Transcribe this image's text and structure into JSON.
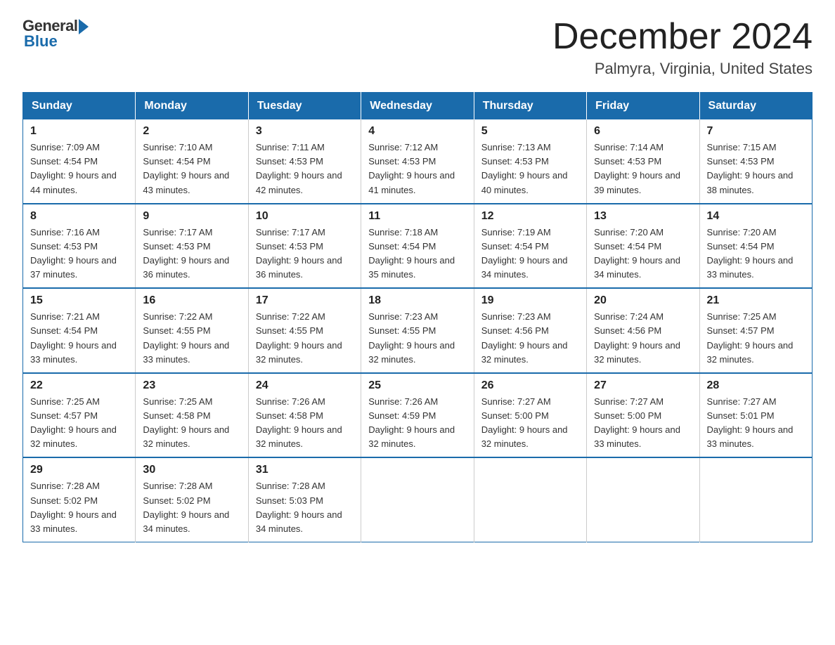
{
  "logo": {
    "general": "General",
    "blue": "Blue"
  },
  "title": "December 2024",
  "subtitle": "Palmyra, Virginia, United States",
  "days_of_week": [
    "Sunday",
    "Monday",
    "Tuesday",
    "Wednesday",
    "Thursday",
    "Friday",
    "Saturday"
  ],
  "weeks": [
    [
      {
        "day": "1",
        "sunrise": "7:09 AM",
        "sunset": "4:54 PM",
        "daylight": "9 hours and 44 minutes."
      },
      {
        "day": "2",
        "sunrise": "7:10 AM",
        "sunset": "4:54 PM",
        "daylight": "9 hours and 43 minutes."
      },
      {
        "day": "3",
        "sunrise": "7:11 AM",
        "sunset": "4:53 PM",
        "daylight": "9 hours and 42 minutes."
      },
      {
        "day": "4",
        "sunrise": "7:12 AM",
        "sunset": "4:53 PM",
        "daylight": "9 hours and 41 minutes."
      },
      {
        "day": "5",
        "sunrise": "7:13 AM",
        "sunset": "4:53 PM",
        "daylight": "9 hours and 40 minutes."
      },
      {
        "day": "6",
        "sunrise": "7:14 AM",
        "sunset": "4:53 PM",
        "daylight": "9 hours and 39 minutes."
      },
      {
        "day": "7",
        "sunrise": "7:15 AM",
        "sunset": "4:53 PM",
        "daylight": "9 hours and 38 minutes."
      }
    ],
    [
      {
        "day": "8",
        "sunrise": "7:16 AM",
        "sunset": "4:53 PM",
        "daylight": "9 hours and 37 minutes."
      },
      {
        "day": "9",
        "sunrise": "7:17 AM",
        "sunset": "4:53 PM",
        "daylight": "9 hours and 36 minutes."
      },
      {
        "day": "10",
        "sunrise": "7:17 AM",
        "sunset": "4:53 PM",
        "daylight": "9 hours and 36 minutes."
      },
      {
        "day": "11",
        "sunrise": "7:18 AM",
        "sunset": "4:54 PM",
        "daylight": "9 hours and 35 minutes."
      },
      {
        "day": "12",
        "sunrise": "7:19 AM",
        "sunset": "4:54 PM",
        "daylight": "9 hours and 34 minutes."
      },
      {
        "day": "13",
        "sunrise": "7:20 AM",
        "sunset": "4:54 PM",
        "daylight": "9 hours and 34 minutes."
      },
      {
        "day": "14",
        "sunrise": "7:20 AM",
        "sunset": "4:54 PM",
        "daylight": "9 hours and 33 minutes."
      }
    ],
    [
      {
        "day": "15",
        "sunrise": "7:21 AM",
        "sunset": "4:54 PM",
        "daylight": "9 hours and 33 minutes."
      },
      {
        "day": "16",
        "sunrise": "7:22 AM",
        "sunset": "4:55 PM",
        "daylight": "9 hours and 33 minutes."
      },
      {
        "day": "17",
        "sunrise": "7:22 AM",
        "sunset": "4:55 PM",
        "daylight": "9 hours and 32 minutes."
      },
      {
        "day": "18",
        "sunrise": "7:23 AM",
        "sunset": "4:55 PM",
        "daylight": "9 hours and 32 minutes."
      },
      {
        "day": "19",
        "sunrise": "7:23 AM",
        "sunset": "4:56 PM",
        "daylight": "9 hours and 32 minutes."
      },
      {
        "day": "20",
        "sunrise": "7:24 AM",
        "sunset": "4:56 PM",
        "daylight": "9 hours and 32 minutes."
      },
      {
        "day": "21",
        "sunrise": "7:25 AM",
        "sunset": "4:57 PM",
        "daylight": "9 hours and 32 minutes."
      }
    ],
    [
      {
        "day": "22",
        "sunrise": "7:25 AM",
        "sunset": "4:57 PM",
        "daylight": "9 hours and 32 minutes."
      },
      {
        "day": "23",
        "sunrise": "7:25 AM",
        "sunset": "4:58 PM",
        "daylight": "9 hours and 32 minutes."
      },
      {
        "day": "24",
        "sunrise": "7:26 AM",
        "sunset": "4:58 PM",
        "daylight": "9 hours and 32 minutes."
      },
      {
        "day": "25",
        "sunrise": "7:26 AM",
        "sunset": "4:59 PM",
        "daylight": "9 hours and 32 minutes."
      },
      {
        "day": "26",
        "sunrise": "7:27 AM",
        "sunset": "5:00 PM",
        "daylight": "9 hours and 32 minutes."
      },
      {
        "day": "27",
        "sunrise": "7:27 AM",
        "sunset": "5:00 PM",
        "daylight": "9 hours and 33 minutes."
      },
      {
        "day": "28",
        "sunrise": "7:27 AM",
        "sunset": "5:01 PM",
        "daylight": "9 hours and 33 minutes."
      }
    ],
    [
      {
        "day": "29",
        "sunrise": "7:28 AM",
        "sunset": "5:02 PM",
        "daylight": "9 hours and 33 minutes."
      },
      {
        "day": "30",
        "sunrise": "7:28 AM",
        "sunset": "5:02 PM",
        "daylight": "9 hours and 34 minutes."
      },
      {
        "day": "31",
        "sunrise": "7:28 AM",
        "sunset": "5:03 PM",
        "daylight": "9 hours and 34 minutes."
      },
      null,
      null,
      null,
      null
    ]
  ]
}
